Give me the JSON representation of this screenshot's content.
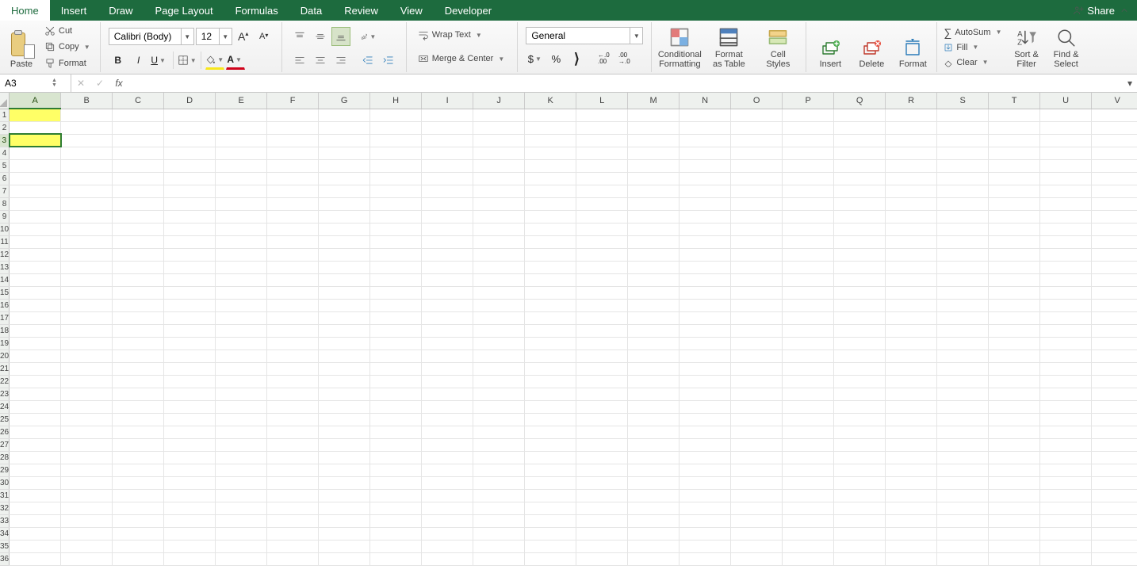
{
  "tabs": [
    "Home",
    "Insert",
    "Draw",
    "Page Layout",
    "Formulas",
    "Data",
    "Review",
    "View",
    "Developer"
  ],
  "active_tab": "Home",
  "share_label": "Share",
  "clipboard": {
    "paste": "Paste",
    "cut": "Cut",
    "copy": "Copy",
    "format": "Format"
  },
  "font": {
    "name": "Calibri (Body)",
    "size": "12",
    "bold": "B",
    "italic": "I",
    "underline": "U"
  },
  "increase_font": "A",
  "decrease_font": "A",
  "align": {
    "wrap": "Wrap Text",
    "merge": "Merge & Center"
  },
  "number": {
    "format": "General",
    "currency": "$",
    "percent": "%",
    "comma": ",",
    "inc": ".00",
    "dec": ".00"
  },
  "styles": {
    "cond": "Conditional\nFormatting",
    "table": "Format\nas Table",
    "cell": "Cell\nStyles"
  },
  "cells": {
    "insert": "Insert",
    "delete": "Delete",
    "format": "Format"
  },
  "editing": {
    "autosum": "AutoSum",
    "fill": "Fill",
    "clear": "Clear",
    "sort": "Sort &\nFilter",
    "find": "Find &\nSelect"
  },
  "namebox_value": "A3",
  "fx_label": "fx",
  "formula_value": "",
  "columns": [
    "A",
    "B",
    "C",
    "D",
    "E",
    "F",
    "G",
    "H",
    "I",
    "J",
    "K",
    "L",
    "M",
    "N",
    "O",
    "P",
    "Q",
    "R",
    "S",
    "T",
    "U",
    "V"
  ],
  "rows": 36,
  "highlighted_cells": [
    "A1",
    "A3"
  ],
  "selected_cell": "A3",
  "selected_col": "A",
  "selected_row": 3
}
